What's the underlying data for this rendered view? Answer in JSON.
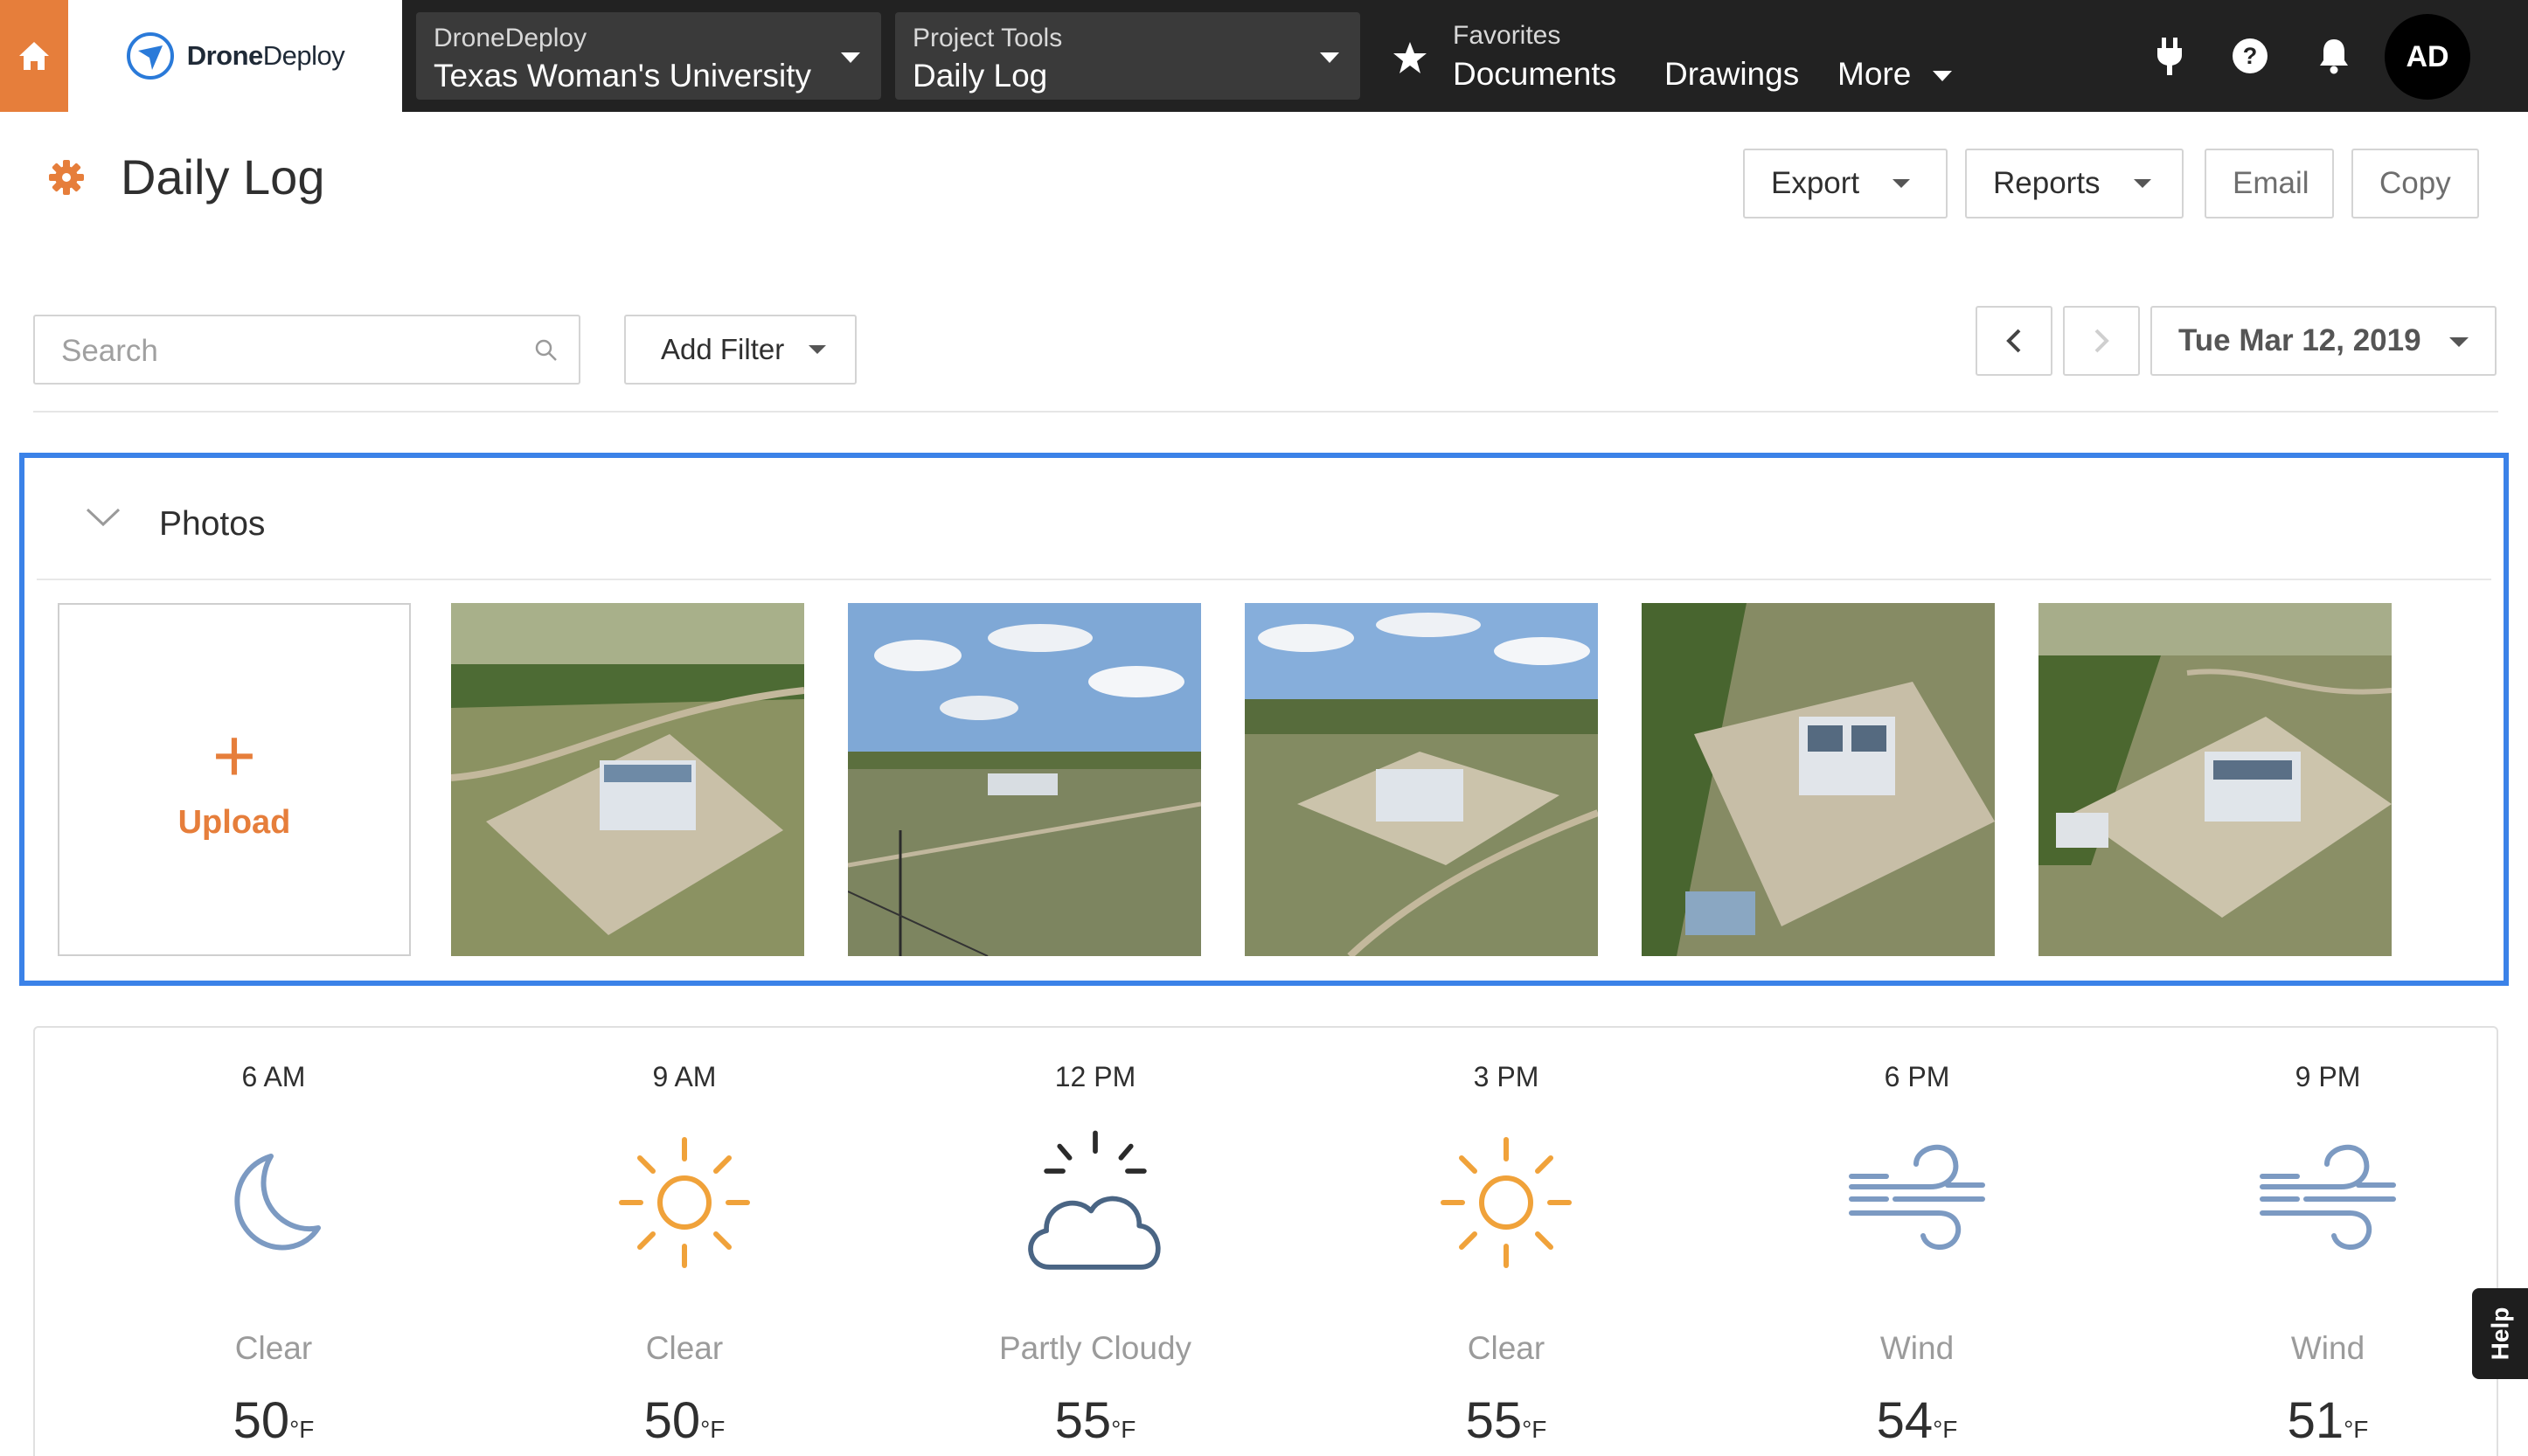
{
  "topnav": {
    "brand_bold": "Drone",
    "brand_rest": "Deploy",
    "company_selector": {
      "small": "DroneDeploy",
      "big": "Texas Woman's University"
    },
    "tool_selector": {
      "small": "Project Tools",
      "big": "Daily Log"
    },
    "favorites_label": "Favorites",
    "links": [
      "Documents",
      "Drawings",
      "More"
    ],
    "avatar_initials": "AD",
    "colors": {
      "bar": "#222222",
      "accent": "#e67e3b"
    }
  },
  "header": {
    "title": "Daily Log",
    "buttons": {
      "export": "Export",
      "reports": "Reports",
      "email": "Email",
      "copy": "Copy"
    }
  },
  "toolbar": {
    "search_placeholder": "Search",
    "filter_label": "Add Filter",
    "date_label": "Tue Mar 12, 2019"
  },
  "photos": {
    "section_title": "Photos",
    "upload_plus": "+",
    "upload_label": "Upload",
    "thumbnail_count": 5
  },
  "weather": [
    {
      "time": "6 AM",
      "icon": "moon-icon",
      "condition": "Clear",
      "temp": "50",
      "unit": "°F"
    },
    {
      "time": "9 AM",
      "icon": "sun-icon",
      "condition": "Clear",
      "temp": "50",
      "unit": "°F"
    },
    {
      "time": "12 PM",
      "icon": "partly-cloudy-icon",
      "condition": "Partly Cloudy",
      "temp": "55",
      "unit": "°F"
    },
    {
      "time": "3 PM",
      "icon": "sun-icon",
      "condition": "Clear",
      "temp": "55",
      "unit": "°F"
    },
    {
      "time": "6 PM",
      "icon": "wind-icon",
      "condition": "Wind",
      "temp": "54",
      "unit": "°F"
    },
    {
      "time": "9 PM",
      "icon": "wind-icon",
      "condition": "Wind",
      "temp": "51",
      "unit": "°F"
    }
  ],
  "help_tab": "Help"
}
